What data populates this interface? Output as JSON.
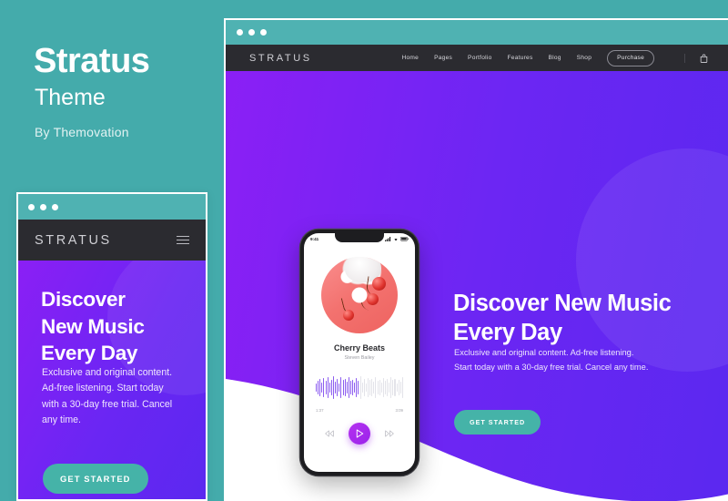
{
  "promo": {
    "title": "Stratus",
    "subtitle": "Theme",
    "byline": "By Themovation"
  },
  "colors": {
    "background_teal": "#44abab",
    "browser_bar_teal": "#4fb2b2",
    "navbar_dark": "#2b2b30",
    "hero_purple_start": "#8b1ff5",
    "hero_purple_end": "#5b28f0",
    "button_teal": "#45b3a8",
    "play_button_purple": "#9a23ea",
    "album_pink": "#f3726f"
  },
  "desktop_mockup": {
    "window_dots": [
      "dot-close",
      "dot-minimize",
      "dot-maximize"
    ],
    "navbar": {
      "logo": "STRATUS",
      "menu": [
        {
          "label": "Home"
        },
        {
          "label": "Pages"
        },
        {
          "label": "Portfolio"
        },
        {
          "label": "Features"
        },
        {
          "label": "Blog"
        },
        {
          "label": "Shop"
        }
      ],
      "purchase_label": "Purchase",
      "cart_icon": "shopping-bag-icon"
    },
    "hero": {
      "heading_line1": "Discover New Music",
      "heading_line2": "Every Day",
      "paragraph_line1": "Exclusive and original content. Ad-free listening.",
      "paragraph_line2": "Start today with a 30-day free trial. Cancel any time.",
      "cta_label": "GET STARTED"
    }
  },
  "mobile_mockup": {
    "window_dots": [
      "dot-close",
      "dot-minimize",
      "dot-maximize"
    ],
    "navbar": {
      "logo": "STRATUS",
      "menu_icon": "hamburger-menu-icon"
    },
    "hero": {
      "heading_line1": "Discover",
      "heading_line2": "New Music",
      "heading_line3": "Every Day",
      "paragraph": "Exclusive and original content. Ad-free listening. Start today with a 30-day free trial. Cancel any time.",
      "cta_label": "GET STARTED"
    }
  },
  "phone": {
    "status_bar": {
      "time": "9:41",
      "icons": [
        "cellular-signal-icon",
        "wifi-icon",
        "battery-icon"
      ]
    },
    "player": {
      "album_art": "cherry-album-art",
      "song_title": "Cherry Beats",
      "artist": "Steven Bailey",
      "elapsed_time": "1:37",
      "total_time": "3:09",
      "progress_percent": 50,
      "controls": {
        "previous": "previous-track-icon",
        "play": "play-icon",
        "next": "next-track-icon"
      }
    }
  }
}
